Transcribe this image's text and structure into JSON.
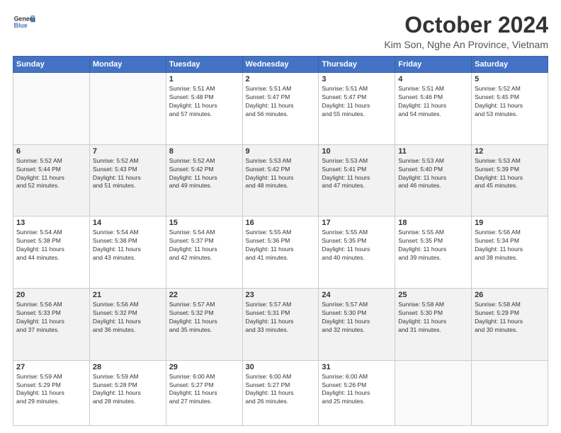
{
  "header": {
    "logo_line1": "General",
    "logo_line2": "Blue",
    "month": "October 2024",
    "location": "Kim Son, Nghe An Province, Vietnam"
  },
  "weekdays": [
    "Sunday",
    "Monday",
    "Tuesday",
    "Wednesday",
    "Thursday",
    "Friday",
    "Saturday"
  ],
  "weeks": [
    [
      {
        "day": "",
        "info": ""
      },
      {
        "day": "",
        "info": ""
      },
      {
        "day": "1",
        "info": "Sunrise: 5:51 AM\nSunset: 5:48 PM\nDaylight: 11 hours\nand 57 minutes."
      },
      {
        "day": "2",
        "info": "Sunrise: 5:51 AM\nSunset: 5:47 PM\nDaylight: 11 hours\nand 56 minutes."
      },
      {
        "day": "3",
        "info": "Sunrise: 5:51 AM\nSunset: 5:47 PM\nDaylight: 11 hours\nand 55 minutes."
      },
      {
        "day": "4",
        "info": "Sunrise: 5:51 AM\nSunset: 5:46 PM\nDaylight: 11 hours\nand 54 minutes."
      },
      {
        "day": "5",
        "info": "Sunrise: 5:52 AM\nSunset: 5:45 PM\nDaylight: 11 hours\nand 53 minutes."
      }
    ],
    [
      {
        "day": "6",
        "info": "Sunrise: 5:52 AM\nSunset: 5:44 PM\nDaylight: 11 hours\nand 52 minutes."
      },
      {
        "day": "7",
        "info": "Sunrise: 5:52 AM\nSunset: 5:43 PM\nDaylight: 11 hours\nand 51 minutes."
      },
      {
        "day": "8",
        "info": "Sunrise: 5:52 AM\nSunset: 5:42 PM\nDaylight: 11 hours\nand 49 minutes."
      },
      {
        "day": "9",
        "info": "Sunrise: 5:53 AM\nSunset: 5:42 PM\nDaylight: 11 hours\nand 48 minutes."
      },
      {
        "day": "10",
        "info": "Sunrise: 5:53 AM\nSunset: 5:41 PM\nDaylight: 11 hours\nand 47 minutes."
      },
      {
        "day": "11",
        "info": "Sunrise: 5:53 AM\nSunset: 5:40 PM\nDaylight: 11 hours\nand 46 minutes."
      },
      {
        "day": "12",
        "info": "Sunrise: 5:53 AM\nSunset: 5:39 PM\nDaylight: 11 hours\nand 45 minutes."
      }
    ],
    [
      {
        "day": "13",
        "info": "Sunrise: 5:54 AM\nSunset: 5:38 PM\nDaylight: 11 hours\nand 44 minutes."
      },
      {
        "day": "14",
        "info": "Sunrise: 5:54 AM\nSunset: 5:38 PM\nDaylight: 11 hours\nand 43 minutes."
      },
      {
        "day": "15",
        "info": "Sunrise: 5:54 AM\nSunset: 5:37 PM\nDaylight: 11 hours\nand 42 minutes."
      },
      {
        "day": "16",
        "info": "Sunrise: 5:55 AM\nSunset: 5:36 PM\nDaylight: 11 hours\nand 41 minutes."
      },
      {
        "day": "17",
        "info": "Sunrise: 5:55 AM\nSunset: 5:35 PM\nDaylight: 11 hours\nand 40 minutes."
      },
      {
        "day": "18",
        "info": "Sunrise: 5:55 AM\nSunset: 5:35 PM\nDaylight: 11 hours\nand 39 minutes."
      },
      {
        "day": "19",
        "info": "Sunrise: 5:56 AM\nSunset: 5:34 PM\nDaylight: 11 hours\nand 38 minutes."
      }
    ],
    [
      {
        "day": "20",
        "info": "Sunrise: 5:56 AM\nSunset: 5:33 PM\nDaylight: 11 hours\nand 37 minutes."
      },
      {
        "day": "21",
        "info": "Sunrise: 5:56 AM\nSunset: 5:32 PM\nDaylight: 11 hours\nand 36 minutes."
      },
      {
        "day": "22",
        "info": "Sunrise: 5:57 AM\nSunset: 5:32 PM\nDaylight: 11 hours\nand 35 minutes."
      },
      {
        "day": "23",
        "info": "Sunrise: 5:57 AM\nSunset: 5:31 PM\nDaylight: 11 hours\nand 33 minutes."
      },
      {
        "day": "24",
        "info": "Sunrise: 5:57 AM\nSunset: 5:30 PM\nDaylight: 11 hours\nand 32 minutes."
      },
      {
        "day": "25",
        "info": "Sunrise: 5:58 AM\nSunset: 5:30 PM\nDaylight: 11 hours\nand 31 minutes."
      },
      {
        "day": "26",
        "info": "Sunrise: 5:58 AM\nSunset: 5:29 PM\nDaylight: 11 hours\nand 30 minutes."
      }
    ],
    [
      {
        "day": "27",
        "info": "Sunrise: 5:59 AM\nSunset: 5:29 PM\nDaylight: 11 hours\nand 29 minutes."
      },
      {
        "day": "28",
        "info": "Sunrise: 5:59 AM\nSunset: 5:28 PM\nDaylight: 11 hours\nand 28 minutes."
      },
      {
        "day": "29",
        "info": "Sunrise: 6:00 AM\nSunset: 5:27 PM\nDaylight: 11 hours\nand 27 minutes."
      },
      {
        "day": "30",
        "info": "Sunrise: 6:00 AM\nSunset: 5:27 PM\nDaylight: 11 hours\nand 26 minutes."
      },
      {
        "day": "31",
        "info": "Sunrise: 6:00 AM\nSunset: 5:26 PM\nDaylight: 11 hours\nand 25 minutes."
      },
      {
        "day": "",
        "info": ""
      },
      {
        "day": "",
        "info": ""
      }
    ]
  ]
}
